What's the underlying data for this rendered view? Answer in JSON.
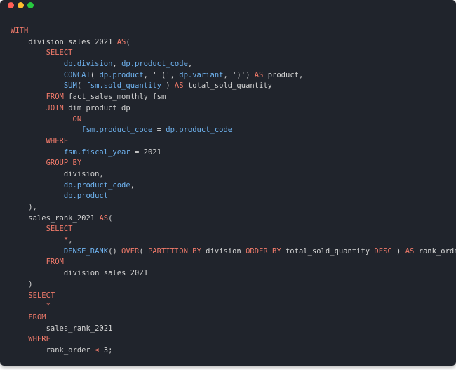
{
  "window": {
    "controls": [
      "close",
      "minimize",
      "maximize"
    ]
  },
  "colors": {
    "background": "#20242c",
    "keyword": "#f07a6a",
    "identifier": "#6fb3f0",
    "text": "#d4d4d4"
  },
  "code": {
    "lines": [
      [
        [
          "kw",
          "WITH"
        ]
      ],
      [
        [
          "tx",
          "    division_sales_2021 "
        ],
        [
          "kw",
          "AS"
        ],
        [
          "tx",
          "("
        ]
      ],
      [
        [
          "tx",
          "        "
        ],
        [
          "kw",
          "SELECT"
        ]
      ],
      [
        [
          "tx",
          "            "
        ],
        [
          "id",
          "dp.division"
        ],
        [
          "tx",
          ", "
        ],
        [
          "id",
          "dp.product_code"
        ],
        [
          "tx",
          ","
        ]
      ],
      [
        [
          "tx",
          "            "
        ],
        [
          "id",
          "CONCAT"
        ],
        [
          "tx",
          "( "
        ],
        [
          "id",
          "dp.product"
        ],
        [
          "tx",
          ", ' (', "
        ],
        [
          "id",
          "dp.variant"
        ],
        [
          "tx",
          ", ')') "
        ],
        [
          "kw",
          "AS"
        ],
        [
          "tx",
          " product,"
        ]
      ],
      [
        [
          "tx",
          "            "
        ],
        [
          "id",
          "SUM"
        ],
        [
          "tx",
          "( "
        ],
        [
          "id",
          "fsm.sold_quantity"
        ],
        [
          "tx",
          " ) "
        ],
        [
          "kw",
          "AS"
        ],
        [
          "tx",
          " total_sold_quantity"
        ]
      ],
      [
        [
          "tx",
          "        "
        ],
        [
          "kw",
          "FROM"
        ],
        [
          "tx",
          " fact_sales_monthly fsm"
        ]
      ],
      [
        [
          "tx",
          "        "
        ],
        [
          "kw",
          "JOIN"
        ],
        [
          "tx",
          " dim_product dp"
        ]
      ],
      [
        [
          "tx",
          "              "
        ],
        [
          "kw",
          "ON"
        ]
      ],
      [
        [
          "tx",
          "                "
        ],
        [
          "id",
          "fsm.product_code"
        ],
        [
          "tx",
          " = "
        ],
        [
          "id",
          "dp.product_code"
        ]
      ],
      [
        [
          "tx",
          "        "
        ],
        [
          "kw",
          "WHERE"
        ]
      ],
      [
        [
          "tx",
          "            "
        ],
        [
          "id",
          "fsm.fiscal_year"
        ],
        [
          "tx",
          " = 2021"
        ]
      ],
      [
        [
          "tx",
          "        "
        ],
        [
          "kw",
          "GROUP BY"
        ]
      ],
      [
        [
          "tx",
          "            division,"
        ]
      ],
      [
        [
          "tx",
          "            "
        ],
        [
          "id",
          "dp.product_code"
        ],
        [
          "tx",
          ","
        ]
      ],
      [
        [
          "tx",
          "            "
        ],
        [
          "id",
          "dp.product"
        ]
      ],
      [
        [
          "tx",
          "    ),"
        ]
      ],
      [
        [
          "tx",
          "    sales_rank_2021 "
        ],
        [
          "kw",
          "AS"
        ],
        [
          "tx",
          "("
        ]
      ],
      [
        [
          "tx",
          "        "
        ],
        [
          "kw",
          "SELECT"
        ]
      ],
      [
        [
          "tx",
          "            "
        ],
        [
          "kw",
          "*"
        ],
        [
          "tx",
          ","
        ]
      ],
      [
        [
          "tx",
          "            "
        ],
        [
          "id",
          "DENSE_RANK"
        ],
        [
          "tx",
          "() "
        ],
        [
          "kw",
          "OVER"
        ],
        [
          "tx",
          "( "
        ],
        [
          "kw",
          "PARTITION BY"
        ],
        [
          "tx",
          " division "
        ],
        [
          "kw",
          "ORDER BY"
        ],
        [
          "tx",
          " total_sold_quantity "
        ],
        [
          "kw",
          "DESC"
        ],
        [
          "tx",
          " ) "
        ],
        [
          "kw",
          "AS"
        ],
        [
          "tx",
          " rank_order"
        ]
      ],
      [
        [
          "tx",
          "        "
        ],
        [
          "kw",
          "FROM"
        ]
      ],
      [
        [
          "tx",
          "            division_sales_2021"
        ]
      ],
      [
        [
          "tx",
          "    )"
        ]
      ],
      [
        [
          "tx",
          "    "
        ],
        [
          "kw",
          "SELECT"
        ]
      ],
      [
        [
          "tx",
          "        "
        ],
        [
          "kw",
          "*"
        ]
      ],
      [
        [
          "tx",
          "    "
        ],
        [
          "kw",
          "FROM"
        ]
      ],
      [
        [
          "tx",
          "        sales_rank_2021"
        ]
      ],
      [
        [
          "tx",
          "    "
        ],
        [
          "kw",
          "WHERE"
        ]
      ],
      [
        [
          "tx",
          "        rank_order "
        ],
        [
          "kw",
          "≤"
        ],
        [
          "tx",
          " 3;"
        ]
      ]
    ]
  }
}
